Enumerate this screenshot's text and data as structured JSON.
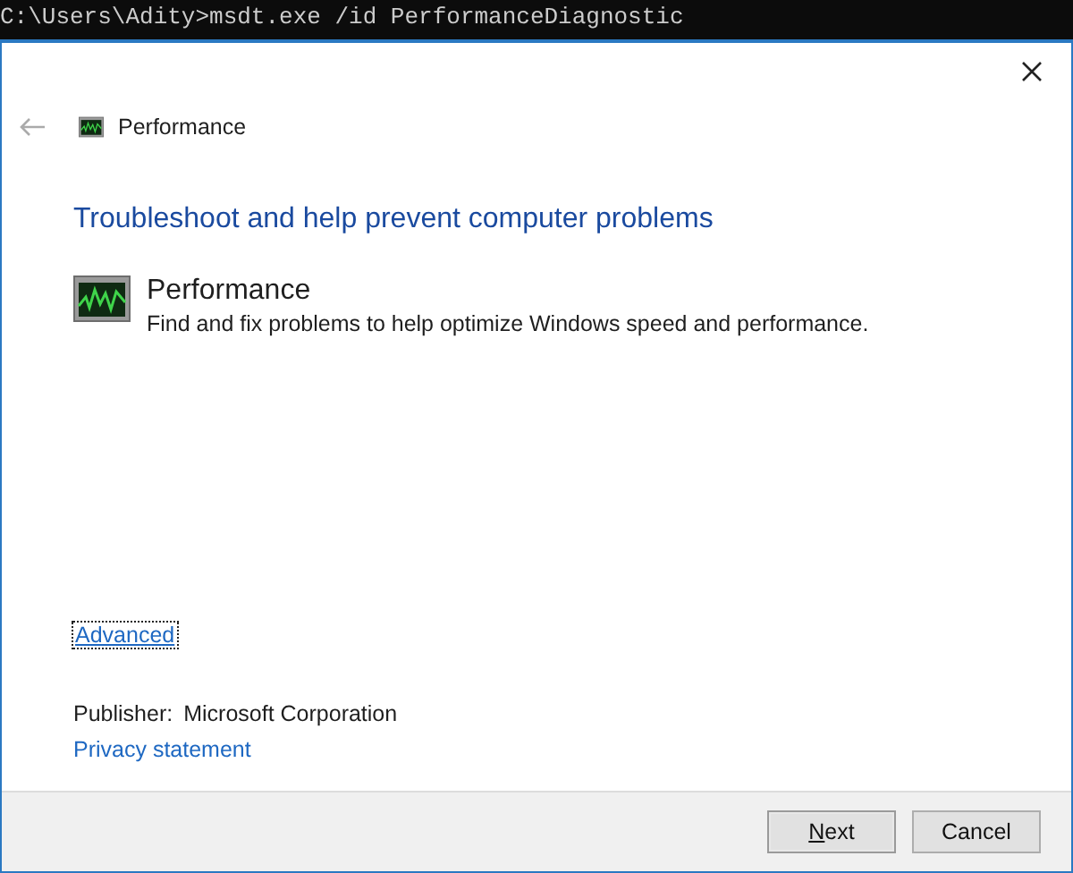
{
  "console": {
    "command_line": "C:\\Users\\Adity>msdt.exe /id PerformanceDiagnostic"
  },
  "window": {
    "title": "Performance"
  },
  "heading": "Troubleshoot and help prevent computer problems",
  "troubleshooter": {
    "name": "Performance",
    "description": "Find and fix problems to help optimize Windows speed and performance."
  },
  "advanced_link": {
    "label": "Advanced",
    "focused": true
  },
  "publisher": {
    "label": "Publisher:",
    "value": "Microsoft Corporation"
  },
  "privacy_link": "Privacy statement",
  "buttons": [
    {
      "label": "Next",
      "kind": "primary"
    },
    {
      "label": "Cancel",
      "kind": "secondary"
    }
  ]
}
